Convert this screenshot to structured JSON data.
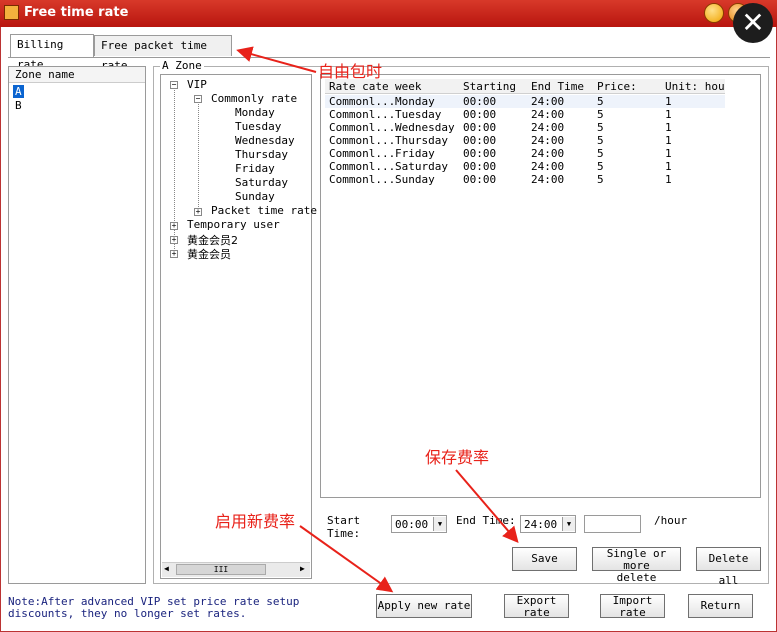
{
  "window": {
    "title": "Free time rate",
    "close_glyph": "✕"
  },
  "tabs": [
    {
      "label": "Billing rate",
      "active": true
    },
    {
      "label": "Free packet time rate",
      "active": false
    }
  ],
  "zones": {
    "header": "Zone name",
    "items": [
      "A",
      "B"
    ],
    "selected": "A"
  },
  "tree": {
    "group_label": "A Zone",
    "vip": "VIP",
    "commonly": "Commonly rate",
    "days": [
      "Monday",
      "Tuesday",
      "Wednesday",
      "Thursday",
      "Friday",
      "Saturday",
      "Sunday"
    ],
    "packet": "Packet time rate",
    "temporary": "Temporary user",
    "gold2": "黄金会员2",
    "gold": "黄金会员",
    "scroll_mid": "III"
  },
  "table": {
    "headers": [
      "Rate cate",
      "week",
      "Starting",
      "End Time",
      "Price:",
      "Unit: hou"
    ],
    "rows": [
      [
        "Commonl...",
        "Monday",
        "00:00",
        "24:00",
        "5",
        "1"
      ],
      [
        "Commonl...",
        "Tuesday",
        "00:00",
        "24:00",
        "5",
        "1"
      ],
      [
        "Commonl...",
        "Wednesday",
        "00:00",
        "24:00",
        "5",
        "1"
      ],
      [
        "Commonl...",
        "Thursday",
        "00:00",
        "24:00",
        "5",
        "1"
      ],
      [
        "Commonl...",
        "Friday",
        "00:00",
        "24:00",
        "5",
        "1"
      ],
      [
        "Commonl...",
        "Saturday",
        "00:00",
        "24:00",
        "5",
        "1"
      ],
      [
        "Commonl...",
        "Sunday",
        "00:00",
        "24:00",
        "5",
        "1"
      ]
    ]
  },
  "form": {
    "start_label_1": "Start",
    "start_label_2": "Time:",
    "start_value": "00:00",
    "end_label": "End Time:",
    "end_value": "24:00",
    "price_value": "",
    "unit_label": "/hour"
  },
  "buttons": {
    "save": "Save",
    "single_delete_1": "Single or more",
    "single_delete_2": "delete",
    "delete_all": "Delete all",
    "apply": "Apply new rate",
    "export_1": "Export",
    "export_2": "rate",
    "import_1": "Import",
    "import_2": "rate",
    "return": "Return"
  },
  "note": {
    "line1": "Note:After advanced VIP set price rate setup",
    "line2": "discounts, they no longer set rates."
  },
  "annotations": {
    "free_packet": "自由包时",
    "save_rate": "保存费率",
    "apply_rate": "启用新费率"
  },
  "colors": {
    "title_bar": "#c8261b",
    "annotation": "#e8221a",
    "selection": "#0a64d0",
    "note_text": "#1a237e"
  }
}
